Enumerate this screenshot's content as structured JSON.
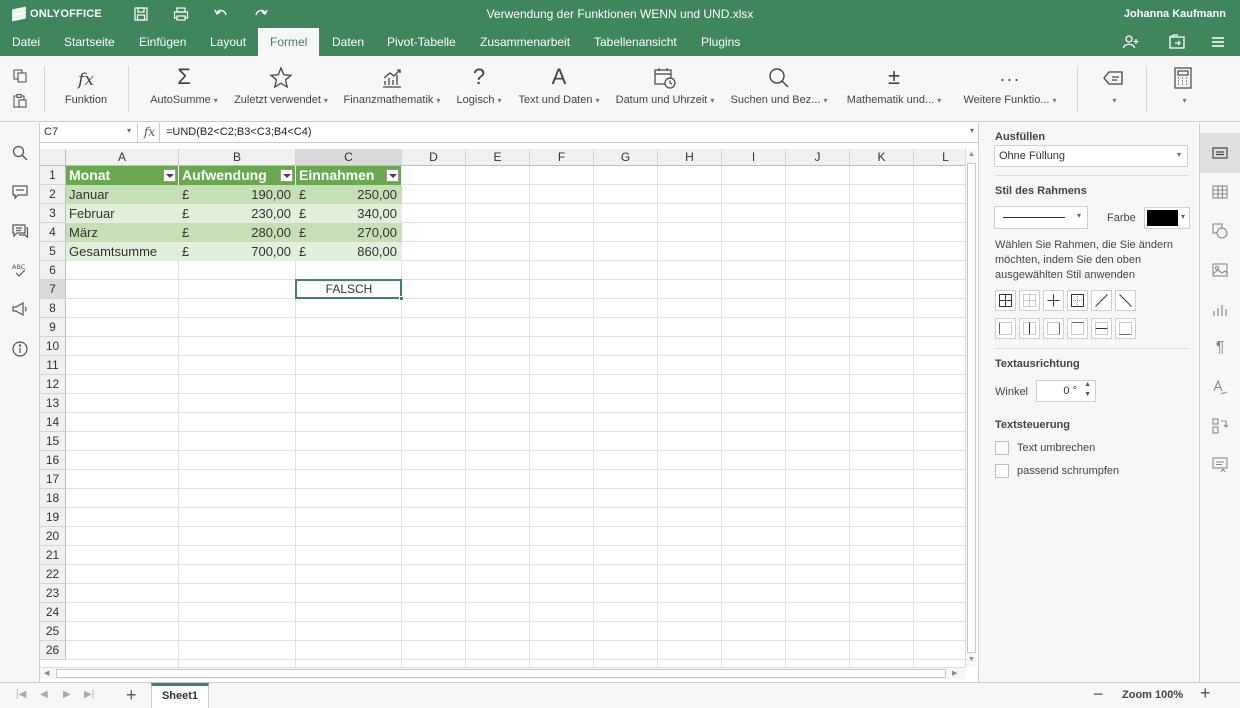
{
  "app": {
    "logo": "ONLYOFFICE",
    "title": "Verwendung der Funktionen WENN und UND.xlsx",
    "user": "Johanna Kaufmann"
  },
  "menu": {
    "tabs": [
      "Datei",
      "Startseite",
      "Einfügen",
      "Layout",
      "Formel",
      "Daten",
      "Pivot-Tabelle",
      "Zusammenarbeit",
      "Tabellenansicht",
      "Plugins"
    ],
    "active": "Formel"
  },
  "toolbar": {
    "function": "Funktion",
    "autosum": "AutoSumme",
    "recent": "Zuletzt verwendet",
    "financial": "Finanzmathematik",
    "logical": "Logisch",
    "text": "Text und Daten",
    "datetime": "Datum und Uhrzeit",
    "lookup": "Suchen und Bez...",
    "math": "Mathematik und...",
    "more": "Weitere Funktio..."
  },
  "formula_bar": {
    "cell": "C7",
    "fx": "fx",
    "formula": "=UND(B2<C2;B3<C3;B4<C4)"
  },
  "grid": {
    "columns": [
      "A",
      "B",
      "C",
      "D",
      "E",
      "F",
      "G",
      "H",
      "I",
      "J",
      "K",
      "L"
    ],
    "rows": [
      "1",
      "2",
      "3",
      "4",
      "5",
      "6",
      "7",
      "8",
      "9",
      "10",
      "11",
      "12",
      "13",
      "14",
      "15",
      "16",
      "17",
      "18",
      "19",
      "20",
      "21",
      "22",
      "23",
      "24",
      "25",
      "26"
    ],
    "headers": [
      "Monat",
      "Aufwendung",
      "Einnahmen"
    ],
    "currency": "£",
    "data": [
      {
        "month": "Januar",
        "expense": "190,00",
        "income": "250,00"
      },
      {
        "month": "Februar",
        "expense": "230,00",
        "income": "340,00"
      },
      {
        "month": "März",
        "expense": "280,00",
        "income": "270,00"
      },
      {
        "month": "Gesamtsumme",
        "expense": "700,00",
        "income": "860,00"
      }
    ],
    "result": "FALSCH"
  },
  "right_panel": {
    "fill_title": "Ausfüllen",
    "fill_value": "Ohne Füllung",
    "border_style_title": "Stil des Rahmens",
    "color_label": "Farbe",
    "border_color": "#000000",
    "border_hint": "Wählen Sie Rahmen, die Sie ändern möchten, indem Sie den oben ausgewählten Stil anwenden",
    "text_orient_title": "Textausrichtung",
    "angle_label": "Winkel",
    "angle_value": "0 °",
    "text_control_title": "Textsteuerung",
    "wrap": "Text umbrechen",
    "shrink": "passend schrumpfen"
  },
  "status": {
    "sheet": "Sheet1",
    "zoom": "Zoom 100%"
  },
  "colors": {
    "brand": "#40865c",
    "table_header": "#6aa84f",
    "band_dark": "#c5e0b4",
    "band_light": "#e2efda"
  }
}
